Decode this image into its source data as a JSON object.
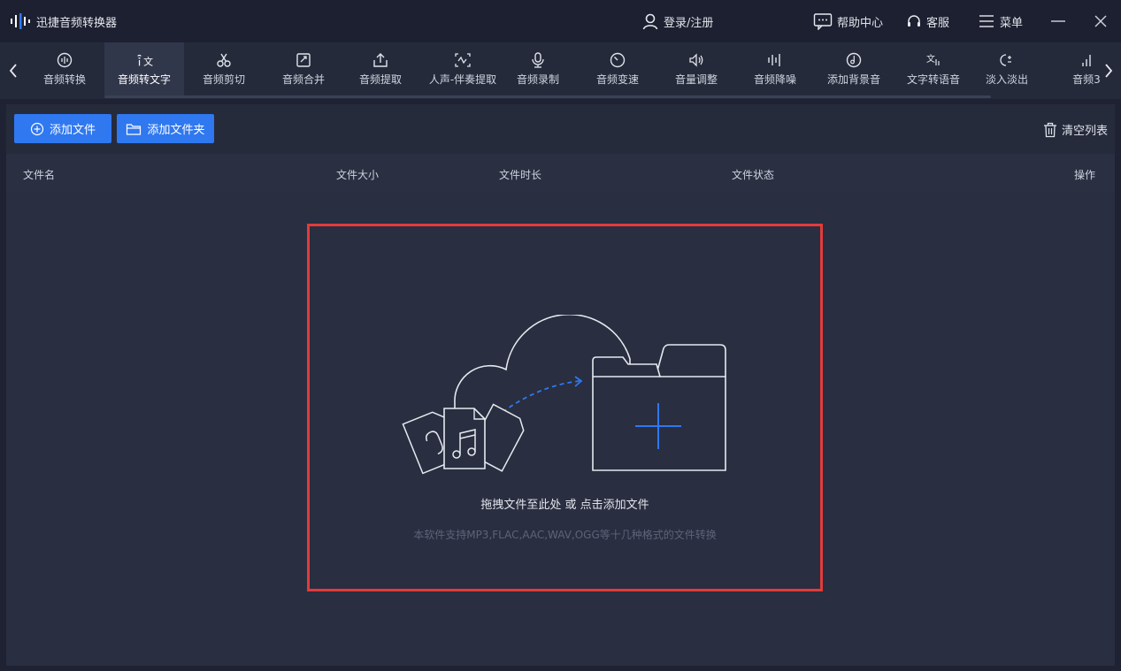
{
  "app": {
    "title": "迅捷音频转换器"
  },
  "titlebar": {
    "login_label": "登录/注册",
    "help_label": "帮助中心",
    "service_label": "客服",
    "menu_label": "菜单"
  },
  "tabs": [
    {
      "label": "音频转换",
      "icon": "audio-convert-icon"
    },
    {
      "label": "音频转文字",
      "icon": "audio-to-text-icon",
      "active": true
    },
    {
      "label": "音频剪切",
      "icon": "scissors-icon"
    },
    {
      "label": "音频合并",
      "icon": "merge-icon"
    },
    {
      "label": "音频提取",
      "icon": "upload-icon"
    },
    {
      "label": "人声-伴奏提取",
      "icon": "vocal-extract-icon"
    },
    {
      "label": "音频录制",
      "icon": "microphone-icon"
    },
    {
      "label": "音频变速",
      "icon": "speed-icon"
    },
    {
      "label": "音量调整",
      "icon": "volume-icon"
    },
    {
      "label": "音频降噪",
      "icon": "denoise-icon"
    },
    {
      "label": "添加背景音",
      "icon": "background-music-icon"
    },
    {
      "label": "文字转语音",
      "icon": "text-to-speech-icon"
    },
    {
      "label": "淡入淡出",
      "icon": "fade-icon"
    },
    {
      "label": "音频3",
      "icon": "audio-bars-icon"
    }
  ],
  "actions": {
    "add_file_label": "添加文件",
    "add_folder_label": "添加文件夹",
    "clear_list_label": "清空列表"
  },
  "table": {
    "columns": [
      "文件名",
      "文件大小",
      "文件时长",
      "文件状态",
      "操作"
    ]
  },
  "dropzone": {
    "hint": "拖拽文件至此处 或 点击添加文件",
    "sub": "本软件支持MP3,FLAC,AAC,WAV,OGG等十几种格式的文件转换"
  },
  "colors": {
    "accent": "#2f78f0",
    "highlight_border": "#e23b3b",
    "background": "#1f2232"
  }
}
